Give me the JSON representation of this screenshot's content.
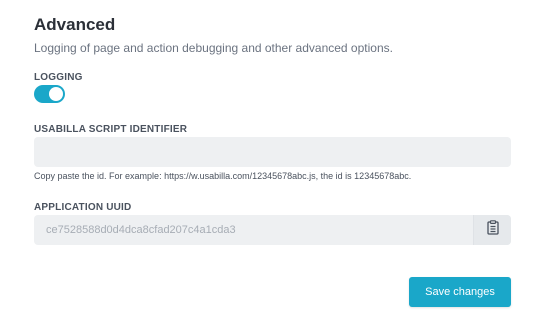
{
  "section": {
    "title": "Advanced",
    "subtitle": "Logging of page and action debugging and other advanced options."
  },
  "logging": {
    "label": "LOGGING",
    "enabled": true
  },
  "script_identifier": {
    "label": "USABILLA SCRIPT IDENTIFIER",
    "value": "",
    "placeholder": "",
    "helper": "Copy paste the id. For example: https://w.usabilla.com/12345678abc.js, the id is 12345678abc."
  },
  "application_uuid": {
    "label": "APPLICATION UUID",
    "value": "ce7528588d0d4dca8cfad207c4a1cda3",
    "copy_icon": "clipboard-icon"
  },
  "actions": {
    "save_label": "Save changes"
  },
  "colors": {
    "accent": "#1aa7c9",
    "field_bg": "#eef0f2"
  }
}
